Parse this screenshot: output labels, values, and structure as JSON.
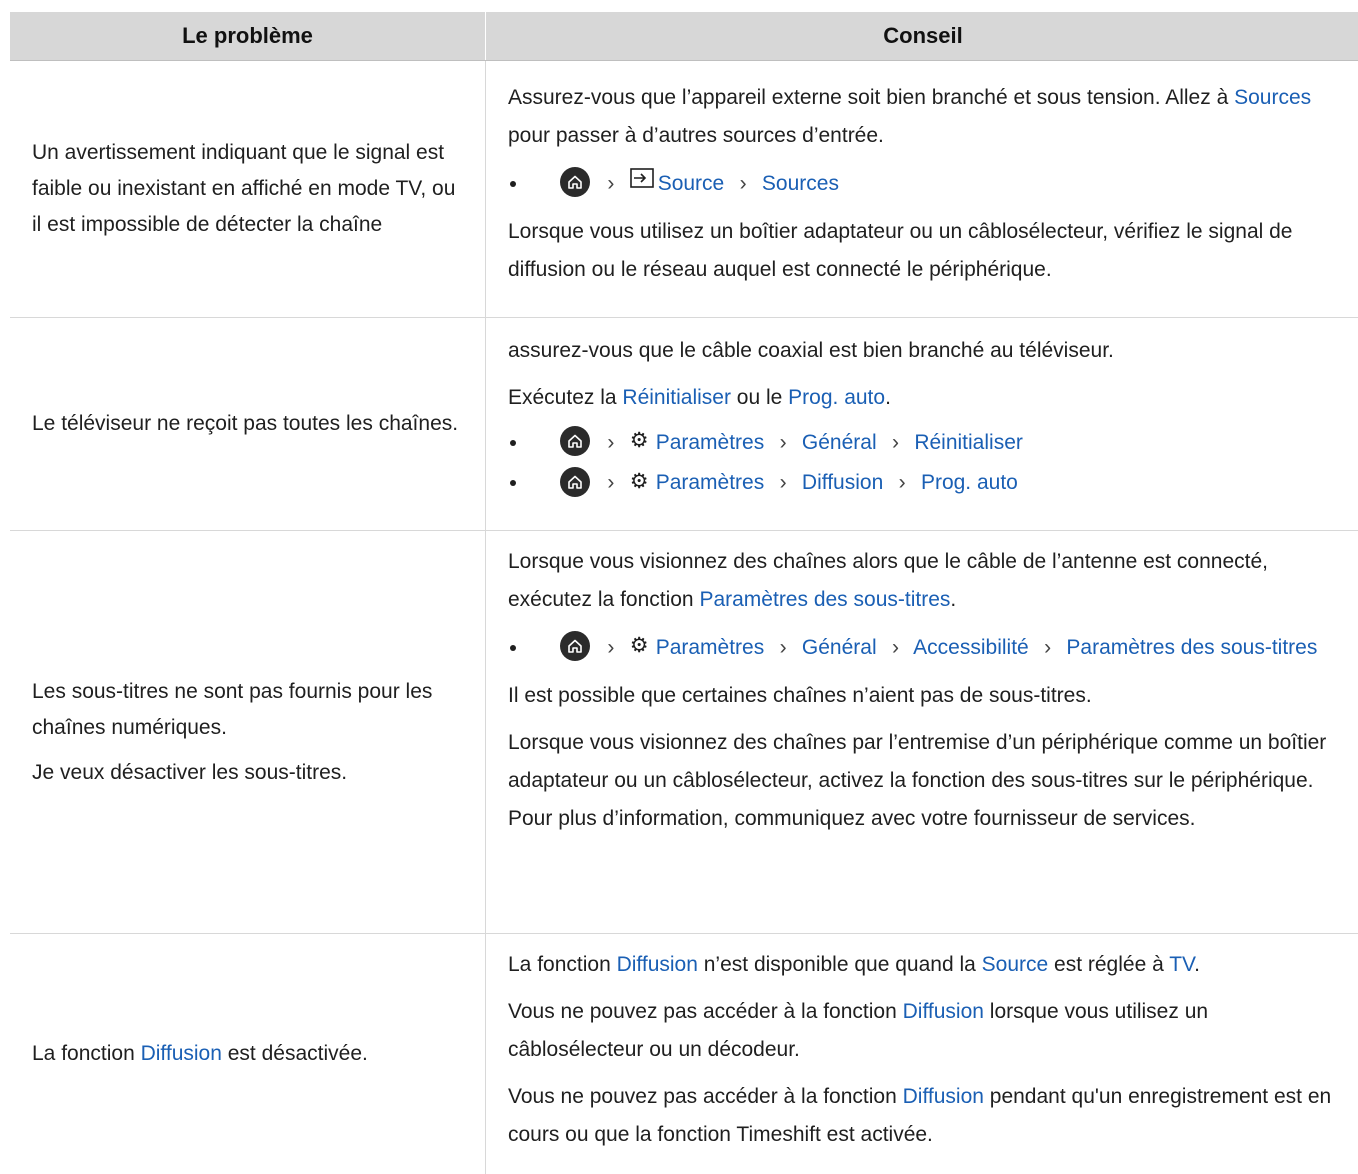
{
  "header": {
    "col1": "Le problème",
    "col2": "Conseil"
  },
  "row1": {
    "problem": "Un avertissement indiquant que le signal est faible ou inexistant en affiché en mode TV, ou il est impossible de détecter la chaîne",
    "p1a": "Assurez-vous que l’appareil externe soit bien branché et sous tension. Allez à ",
    "p1link": "Sources",
    "p1b": " pour passer à d’autres sources d’entrée.",
    "path": [
      "Source",
      "Sources"
    ],
    "p2": "Lorsque vous utilisez un boîtier adaptateur ou un câblosélecteur, vérifiez le signal de diffusion ou le réseau auquel est connecté le périphérique."
  },
  "row2": {
    "problem": "Le téléviseur ne reçoit pas toutes les chaînes.",
    "p1": "assurez-vous que le câble coaxial est bien branché au téléviseur.",
    "p2a": "Exécutez la ",
    "p2link1": "Réinitialiser",
    "p2b": " ou le ",
    "p2link2": "Prog. auto",
    "p2c": ".",
    "path1": [
      "Paramètres",
      "Général",
      "Réinitialiser"
    ],
    "path2": [
      "Paramètres",
      "Diffusion",
      "Prog. auto"
    ]
  },
  "row3": {
    "problem1": "Les sous-titres ne sont pas fournis pour les chaînes numériques.",
    "problem2": "Je veux désactiver les sous-titres.",
    "p1a": "Lorsque vous visionnez des chaînes alors que le câble de l’antenne est connecté, exécutez la fonction ",
    "p1link": "Paramètres des sous-titres",
    "p1b": ".",
    "path": [
      "Paramètres",
      "Général",
      "Accessibilité",
      "Paramètres des sous-titres"
    ],
    "p2": "Il est possible que certaines chaînes n’aient pas de sous-titres.",
    "p3": "Lorsque vous visionnez des chaînes par l’entremise d’un périphérique comme un boîtier adaptateur ou un câblosélecteur, activez la fonction des sous-titres sur le périphérique. Pour plus d’information, communiquez avec votre fournisseur de services."
  },
  "row4": {
    "problem_a": "La fonction ",
    "problem_link": "Diffusion",
    "problem_b": " est désactivée.",
    "p1a": "La fonction ",
    "p1link1": "Diffusion",
    "p1b": " n’est disponible que quand la ",
    "p1link2": "Source",
    "p1c": " est réglée à ",
    "p1link3": "TV",
    "p1d": ".",
    "p2a": "Vous ne pouvez pas accéder à la fonction ",
    "p2link": "Diffusion",
    "p2b": " lorsque vous utilisez un câblosélecteur ou un décodeur.",
    "p3a": "Vous ne pouvez pas accéder à la fonction ",
    "p3link": "Diffusion",
    "p3b": " pendant qu'un enregistrement est en cours ou que la fonction Timeshift est activée."
  },
  "colors": {
    "link": "#1a5fb4",
    "header_bg": "#d7d7d7",
    "border": "#d8d8d8"
  },
  "icons": [
    "home-icon",
    "chevron-right-icon",
    "source-input-icon",
    "gear-icon"
  ]
}
